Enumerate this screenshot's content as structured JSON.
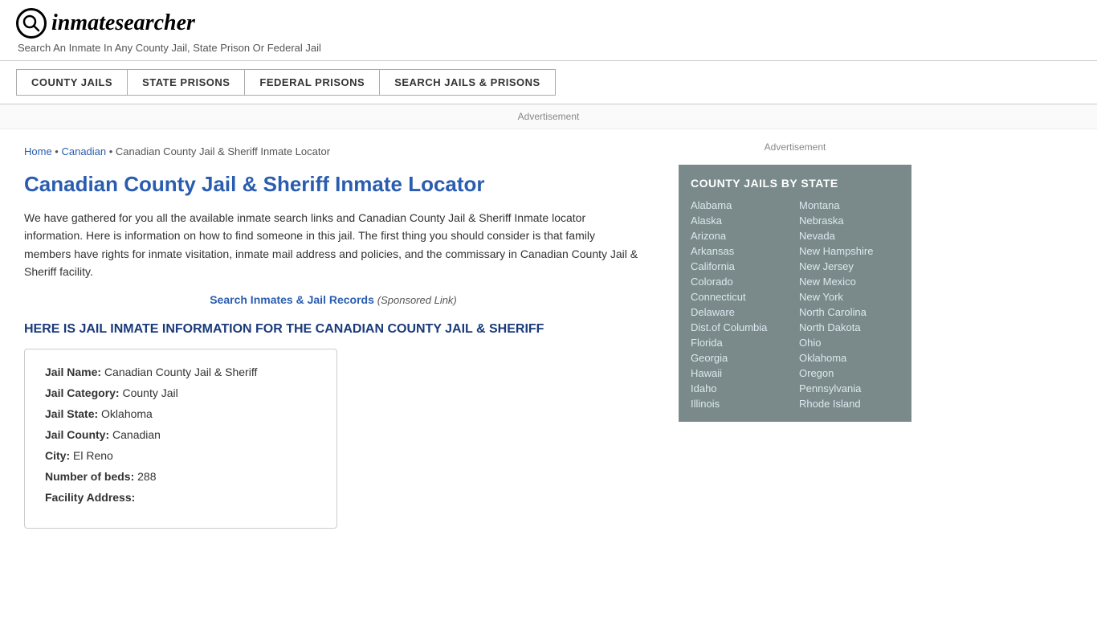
{
  "header": {
    "logo_icon": "Q",
    "logo_text_part1": "inmate",
    "logo_text_part2": "searcher",
    "tagline": "Search An Inmate In Any County Jail, State Prison Or Federal Jail"
  },
  "nav": {
    "items": [
      {
        "label": "COUNTY JAILS"
      },
      {
        "label": "STATE PRISONS"
      },
      {
        "label": "FEDERAL PRISONS"
      },
      {
        "label": "SEARCH JAILS & PRISONS"
      }
    ]
  },
  "ad_label": "Advertisement",
  "breadcrumb": {
    "home": "Home",
    "separator1": " • ",
    "canadian": "Canadian",
    "separator2": " • ",
    "current": "Canadian County Jail & Sheriff Inmate Locator"
  },
  "page_title": "Canadian County Jail & Sheriff Inmate Locator",
  "intro_text": "We have gathered for you all the available inmate search links and Canadian County Jail & Sheriff Inmate locator information. Here is information on how to find someone in this jail. The first thing you should consider is that family members have rights for inmate visitation, inmate mail address and policies, and the commissary in Canadian County Jail & Sheriff facility.",
  "search_link": {
    "text": "Search Inmates & Jail Records",
    "sponsored": "(Sponsored Link)"
  },
  "section_heading": "HERE IS JAIL INMATE INFORMATION FOR THE CANADIAN COUNTY JAIL & SHERIFF",
  "jail_info": {
    "name_label": "Jail Name:",
    "name_value": "Canadian County Jail & Sheriff",
    "category_label": "Jail Category:",
    "category_value": "County Jail",
    "state_label": "Jail State:",
    "state_value": "Oklahoma",
    "county_label": "Jail County:",
    "county_value": "Canadian",
    "city_label": "City:",
    "city_value": "El Reno",
    "beds_label": "Number of beds:",
    "beds_value": "288",
    "address_label": "Facility Address:"
  },
  "sidebar": {
    "ad_label": "Advertisement",
    "county_jails_title": "COUNTY JAILS BY STATE",
    "states_col1": [
      "Alabama",
      "Alaska",
      "Arizona",
      "Arkansas",
      "California",
      "Colorado",
      "Connecticut",
      "Delaware",
      "Dist.of Columbia",
      "Florida",
      "Georgia",
      "Hawaii",
      "Idaho",
      "Illinois"
    ],
    "states_col2": [
      "Montana",
      "Nebraska",
      "Nevada",
      "New Hampshire",
      "New Jersey",
      "New Mexico",
      "New York",
      "North Carolina",
      "North Dakota",
      "Ohio",
      "Oklahoma",
      "Oregon",
      "Pennsylvania",
      "Rhode Island"
    ]
  }
}
